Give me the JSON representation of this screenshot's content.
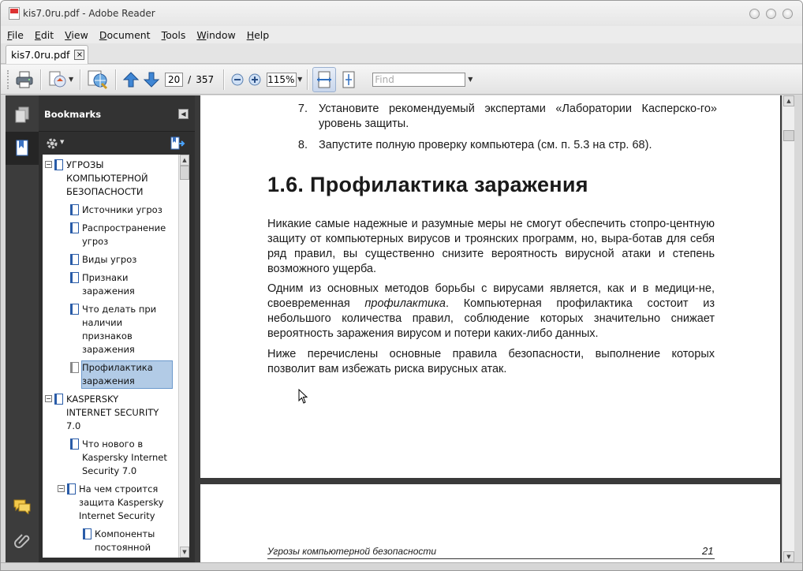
{
  "window": {
    "title": "kis7.0ru.pdf - Adobe Reader"
  },
  "menu": {
    "items": [
      {
        "first": "F",
        "rest": "ile"
      },
      {
        "first": "E",
        "rest": "dit"
      },
      {
        "first": "V",
        "rest": "iew"
      },
      {
        "first": "D",
        "rest": "ocument"
      },
      {
        "first": "T",
        "rest": "ools"
      },
      {
        "first": "W",
        "rest": "indow"
      },
      {
        "first": "H",
        "rest": "elp"
      }
    ]
  },
  "tab": {
    "label": "kis7.0ru.pdf",
    "close": "×"
  },
  "toolbar": {
    "page_current": "20",
    "page_separator": "/",
    "page_total": "357",
    "zoom": "115%",
    "find_placeholder": "Find"
  },
  "colors": {
    "rail_bg": "#3c3c3c",
    "panel_bg": "#2f2f2f",
    "selection": "#b2cbe6",
    "icon_blue": "#2a5ca8",
    "doc_bg": "#3a3a3a"
  },
  "bookmarks": {
    "title": "Bookmarks",
    "items": [
      {
        "text": "УГРОЗЫ КОМПЬЮТЕРНОЙ БЕЗОПАСНОСТИ",
        "expander": "−"
      },
      {
        "text": "Источники угроз"
      },
      {
        "text": "Распространение угроз"
      },
      {
        "text": "Виды угроз"
      },
      {
        "text": "Признаки заражения"
      },
      {
        "text": "Что делать при наличии признаков заражения"
      },
      {
        "text": "Профилактика заражения"
      },
      {
        "text": "KASPERSKY INTERNET SECURITY 7.0",
        "expander": "−"
      },
      {
        "text": "Что нового в Kaspersky Internet Security 7.0"
      },
      {
        "text": "На чем строится защита Kaspersky Internet Security",
        "expander": "−"
      },
      {
        "text": "Компоненты постоянной"
      }
    ]
  },
  "document": {
    "list": [
      {
        "num": "7.",
        "text": "Установите рекомендуемый экспертами «Лаборатории Касперско-го» уровень защиты."
      },
      {
        "num": "8.",
        "text": "Запустите полную проверку компьютера (см. п. 5.3 на стр. 68)."
      }
    ],
    "heading": "1.6. Профилактика заражения",
    "para1": "Никакие самые надежные и разумные меры не смогут обеспечить стопро-центную защиту от компьютерных вирусов и троянских программ, но, выра-ботав для себя ряд правил, вы существенно снизите вероятность вирусной атаки и степень возможного ущерба.",
    "para2_before": "Одним из основных методов борьбы с вирусами является, как и в медици-не, своевременная ",
    "para2_em": "профилактика",
    "para2_after": ". Компьютерная профилактика состоит из небольшого количества правил, соблюдение которых значительно снижает вероятность заражения вирусом и потери каких-либо данных.",
    "para3": "Ниже перечислены основные правила безопасности, выполнение которых позволит вам избежать риска вирусных атак.",
    "footer_text": "Угрозы компьютерной безопасности",
    "footer_page": "21"
  }
}
